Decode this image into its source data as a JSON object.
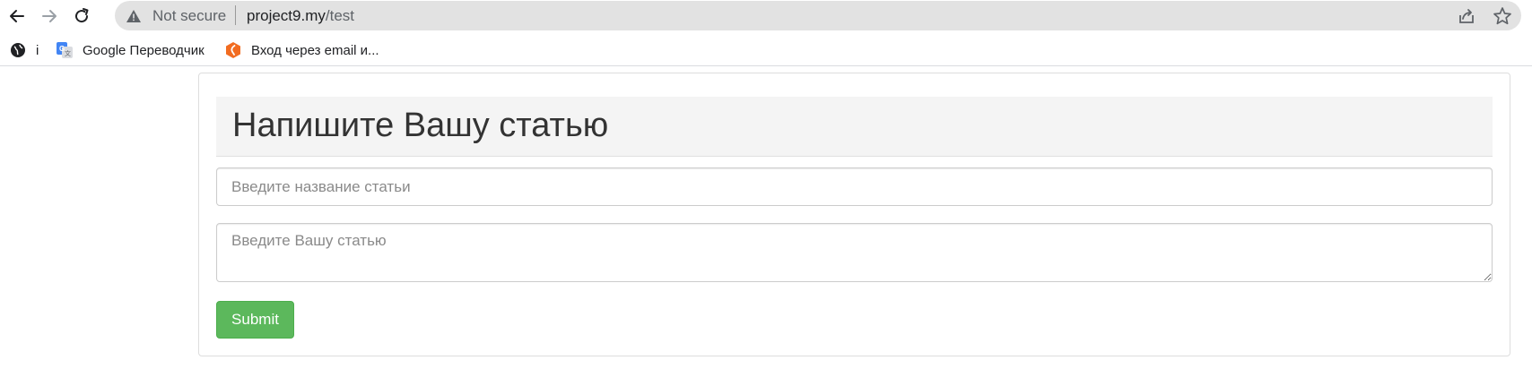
{
  "browser": {
    "security_label": "Not secure",
    "url_host": "project9.my",
    "url_path": "/test",
    "bookmarks": [
      {
        "label": "i",
        "icon": "globe-icon"
      },
      {
        "label": "Google Переводчик",
        "icon": "google-translate-icon"
      },
      {
        "label": "Вход через email и...",
        "icon": "login-site-icon"
      }
    ]
  },
  "page": {
    "heading": "Напишите Вашу статью",
    "title_input": {
      "placeholder": "Введите название статьи",
      "value": ""
    },
    "body_input": {
      "placeholder": "Введите Вашу статью",
      "value": ""
    },
    "submit_label": "Submit"
  },
  "colors": {
    "submit_bg": "#5cb85c",
    "jumbotron_bg": "#f4f4f4",
    "omnibox_bg": "#e2e2e2"
  }
}
